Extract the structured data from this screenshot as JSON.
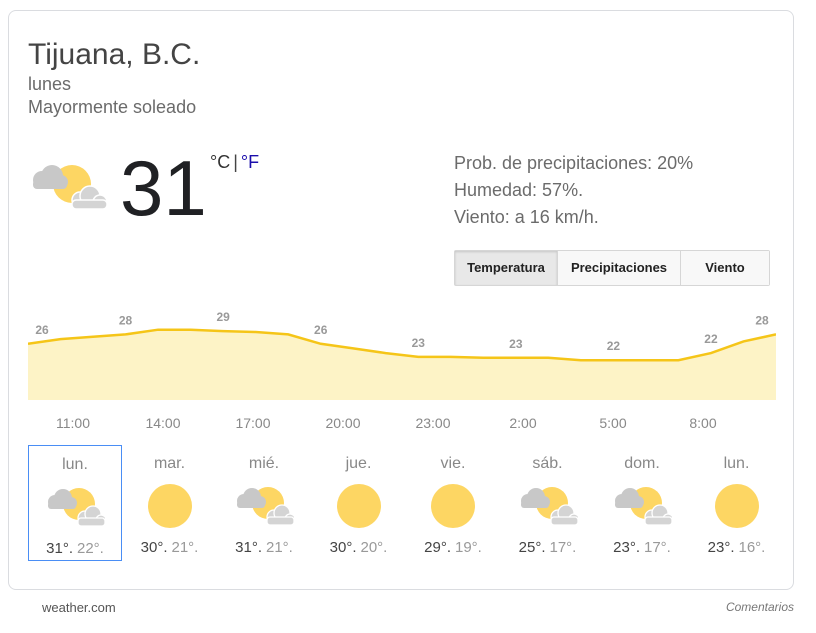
{
  "location": "Tijuana, B.C.",
  "day": "lunes",
  "condition": "Mayormente soleado",
  "current": {
    "temp": "31",
    "unit_c": "°C",
    "unit_sep": "|",
    "unit_f": "°F",
    "icon": "partly-cloudy-icon"
  },
  "details": {
    "precip": "Prob. de precipitaciones: 20%",
    "humidity": "Humedad: 57%.",
    "wind": "Viento: a 16 km/h."
  },
  "tabs": [
    {
      "label": "Temperatura",
      "active": true
    },
    {
      "label": "Precipitaciones",
      "active": false
    },
    {
      "label": "Viento",
      "active": false
    }
  ],
  "chart_data": {
    "type": "area",
    "x": [
      "11:00",
      "12:00",
      "13:00",
      "14:00",
      "15:00",
      "16:00",
      "17:00",
      "18:00",
      "19:00",
      "20:00",
      "21:00",
      "22:00",
      "23:00",
      "0:00",
      "1:00",
      "2:00",
      "3:00",
      "4:00",
      "5:00",
      "6:00",
      "7:00",
      "8:00",
      "9:00",
      "10:00"
    ],
    "values": [
      26,
      27,
      27.5,
      28,
      29,
      29,
      28.7,
      28.5,
      28,
      26,
      25,
      24,
      23.2,
      23.2,
      23,
      23,
      23,
      22.5,
      22.5,
      22.5,
      22.5,
      24,
      26.5,
      28
    ],
    "label_indices": [
      0,
      3,
      6,
      9,
      12,
      15,
      18,
      21,
      23
    ],
    "labels": [
      "26",
      "28",
      "29",
      "26",
      "23",
      "23",
      "22",
      "22",
      "28"
    ],
    "tick_labels": [
      "11:00",
      "14:00",
      "17:00",
      "20:00",
      "23:00",
      "2:00",
      "5:00",
      "8:00"
    ],
    "ylim": [
      14,
      30
    ],
    "line_color": "#f5c518",
    "fill_color": "#fdf3c6"
  },
  "forecast": [
    {
      "day": "lun.",
      "hi": "31°.",
      "lo": "22°.",
      "icon": "partly-cloudy-icon",
      "selected": true
    },
    {
      "day": "mar.",
      "hi": "30°.",
      "lo": "21°.",
      "icon": "sunny-icon",
      "selected": false
    },
    {
      "day": "mié.",
      "hi": "31°.",
      "lo": "21°.",
      "icon": "partly-cloudy-icon",
      "selected": false
    },
    {
      "day": "jue.",
      "hi": "30°.",
      "lo": "20°.",
      "icon": "sunny-icon",
      "selected": false
    },
    {
      "day": "vie.",
      "hi": "29°.",
      "lo": "19°.",
      "icon": "sunny-icon",
      "selected": false
    },
    {
      "day": "sáb.",
      "hi": "25°.",
      "lo": "17°.",
      "icon": "partly-cloudy-icon",
      "selected": false
    },
    {
      "day": "dom.",
      "hi": "23°.",
      "lo": "17°.",
      "icon": "partly-cloudy-icon",
      "selected": false
    },
    {
      "day": "lun.",
      "hi": "23°.",
      "lo": "16°.",
      "icon": "sunny-icon",
      "selected": false
    }
  ],
  "footer": {
    "source": "weather.com",
    "feedback": "Comentarios"
  },
  "colors": {
    "sun": "#fdd663",
    "cloud": "#d0d0d0",
    "selected_border": "#4a8ef5"
  }
}
